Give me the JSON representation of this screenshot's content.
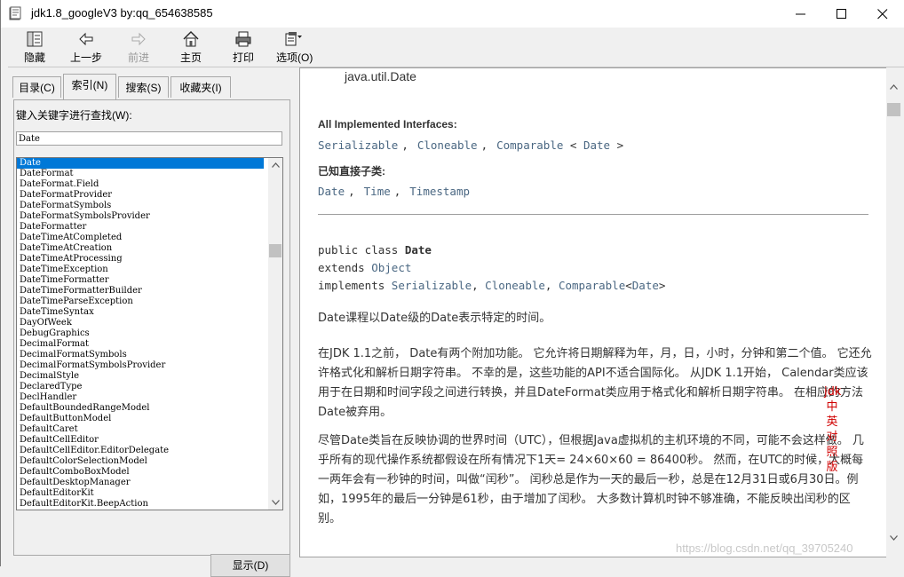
{
  "window": {
    "title": "jdk1.8_googleV3 by:qq_654638585"
  },
  "toolbar": {
    "hide": "隐藏",
    "back": "上一步",
    "forward": "前进",
    "home": "主页",
    "print": "打印",
    "options": "选项(O)"
  },
  "tabs": [
    "目录(C)",
    "索引(N)",
    "搜索(S)",
    "收藏夹(I)"
  ],
  "index": {
    "label": "键入关键字进行查找(W):",
    "input_value": "Date",
    "items": [
      "Date",
      "DateFormat",
      "DateFormat.Field",
      "DateFormatProvider",
      "DateFormatSymbols",
      "DateFormatSymbolsProvider",
      "DateFormatter",
      "DateTimeAtCompleted",
      "DateTimeAtCreation",
      "DateTimeAtProcessing",
      "DateTimeException",
      "DateTimeFormatter",
      "DateTimeFormatterBuilder",
      "DateTimeParseException",
      "DateTimeSyntax",
      "DayOfWeek",
      "DebugGraphics",
      "DecimalFormat",
      "DecimalFormatSymbols",
      "DecimalFormatSymbolsProvider",
      "DecimalStyle",
      "DeclaredType",
      "DeclHandler",
      "DefaultBoundedRangeModel",
      "DefaultButtonModel",
      "DefaultCaret",
      "DefaultCellEditor",
      "DefaultCellEditor.EditorDelegate",
      "DefaultColorSelectionModel",
      "DefaultComboBoxModel",
      "DefaultDesktopManager",
      "DefaultEditorKit",
      "DefaultEditorKit.BeepAction"
    ],
    "selected": "Date",
    "show_button": "显示(D)"
  },
  "doc": {
    "package": "java.util.Date",
    "impl_heading": "All Implemented Interfaces:",
    "impl_items": [
      "Serializable",
      "Cloneable",
      "Comparable",
      "<",
      "Date",
      ">"
    ],
    "subclass_heading": "已知直接子类:",
    "subclasses": [
      "Date",
      "Time",
      "Timestamp"
    ],
    "decl": {
      "kw_public": "public class ",
      "class_name": "Date",
      "kw_extends": "extends ",
      "extends_name": "Object",
      "kw_implements": "implements ",
      "impl1": "Serializable",
      "impl2": "Cloneable",
      "impl3": "Comparable",
      "impl3_generic": "Date"
    },
    "p1": "Date课程以Date级的Date表示特定的时间。",
    "p2": "在JDK 1.1之前， Date有两个附加功能。 它允许将日期解释为年，月，日，小时，分钟和第二个值。 它还允许格式化和解析日期字符串。 不幸的是，这些功能的API不适合国际化。 从JDK 1.1开始， Calendar类应该用于在日期和时间字段之间进行转换，并且DateFormat类应用于格式化和解析日期字符串。 在相应的方法Date被弃用。",
    "p3": "尽管Date类旨在反映协调的世界时间（UTC），但根据Java虚拟机的主机环境的不同，可能不会这样做。 几乎所有的现代操作系统都假设在所有情况下1天= 24×60×60 = 86400秒。 然而，在UTC的时候，大概每一两年会有一秒钟的时间，叫做“闰秒”。 闰秒总是作为一天的最后一秒，总是在12月31日或6月30日。例如，1995年的最后一分钟是61秒，由于增加了闰秒。 大多数计算机时钟不够准确，不能反映出闰秒的区别。",
    "red_mark": "jdk中英对照版",
    "watermark": "https://blog.csdn.net/qq_39705240"
  }
}
